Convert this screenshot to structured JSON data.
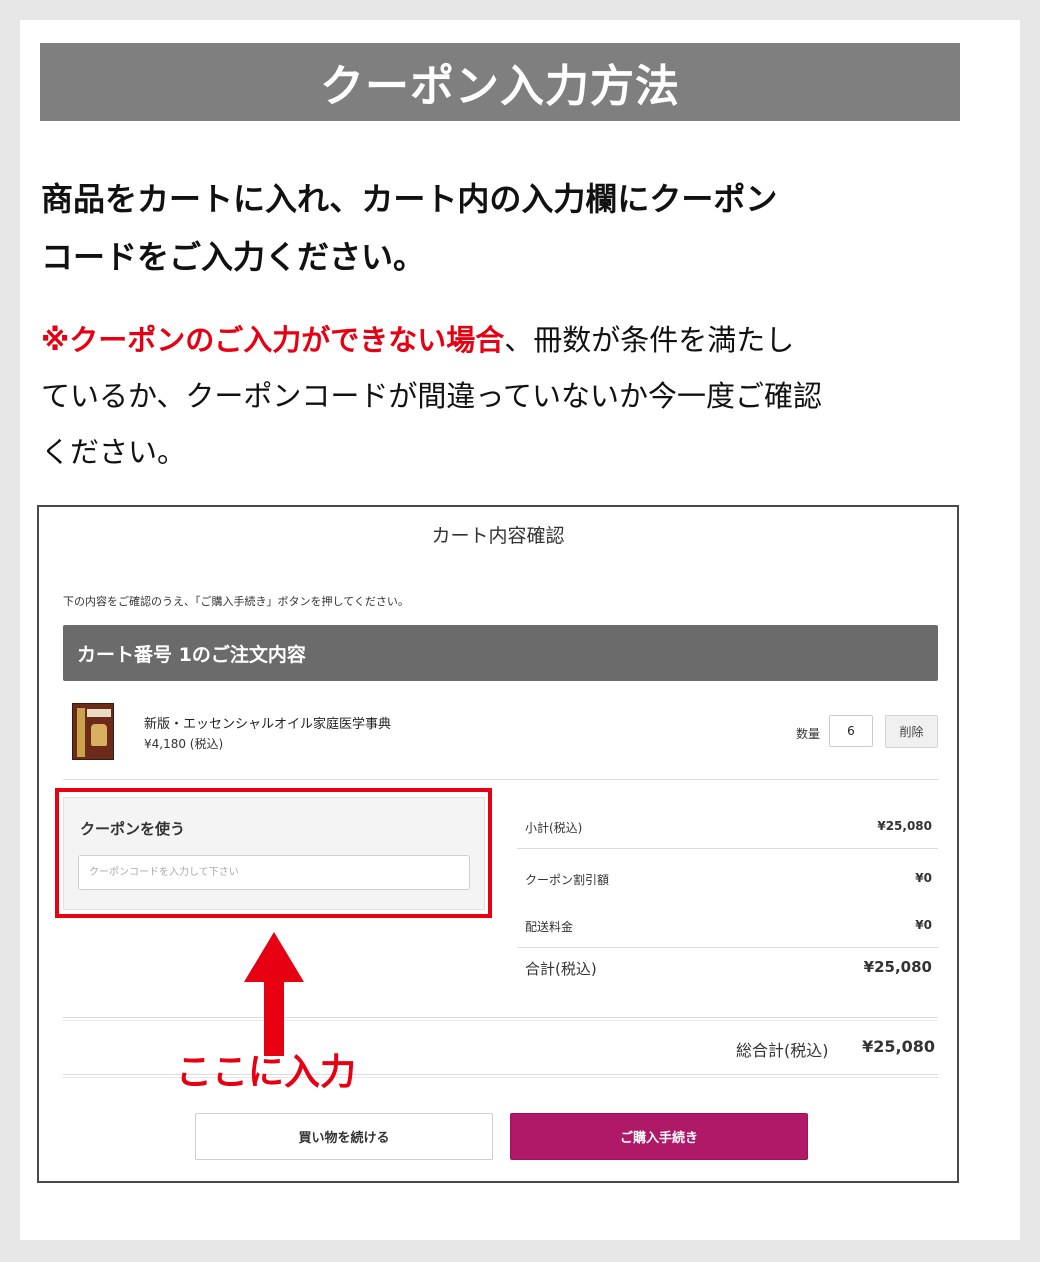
{
  "heading": "クーポン入力方法",
  "lead_line1": "商品をカートに入れ、カート内の入力欄にクーポン",
  "lead_line2": "コードをご入力ください。",
  "note": {
    "highlight": "※クーポンのご入力ができない場合",
    "rest_line1": "、冊数が条件を満たし",
    "line2": "ているか、クーポンコードが間違っていないか今一度ご確認",
    "line3": "ください。"
  },
  "screenshot": {
    "title": "カート内容確認",
    "instruction": "下の内容をご確認のうえ、「ご購入手続き」ボタンを押してください。",
    "cart_header": "カート番号 1のご注文内容",
    "product": {
      "name": "新版・エッセンシャルオイル家庭医学事典",
      "price": "¥4,180 (税込)",
      "qty_label": "数量",
      "qty_value": "6",
      "delete_label": "削除"
    },
    "coupon": {
      "label": "クーポンを使う",
      "placeholder": "クーポンコードを入力して下さい"
    },
    "summary": [
      {
        "label": "小計(税込)",
        "value": "¥25,080"
      },
      {
        "label": "クーポン割引額",
        "value": "¥0"
      },
      {
        "label": "配送料金",
        "value": "¥0"
      },
      {
        "label": "合計(税込)",
        "value": "¥25,080"
      }
    ],
    "grand_total_label": "総合計(税込)",
    "grand_total_value": "¥25,080",
    "continue_label": "買い物を続ける",
    "checkout_label": "ご購入手続き"
  },
  "annotation_text": "ここに入力",
  "colors": {
    "banner": "#7f7f7f",
    "highlight_red": "#e60012",
    "cart_header": "#6b6b6b",
    "checkout_button": "#b01868"
  }
}
